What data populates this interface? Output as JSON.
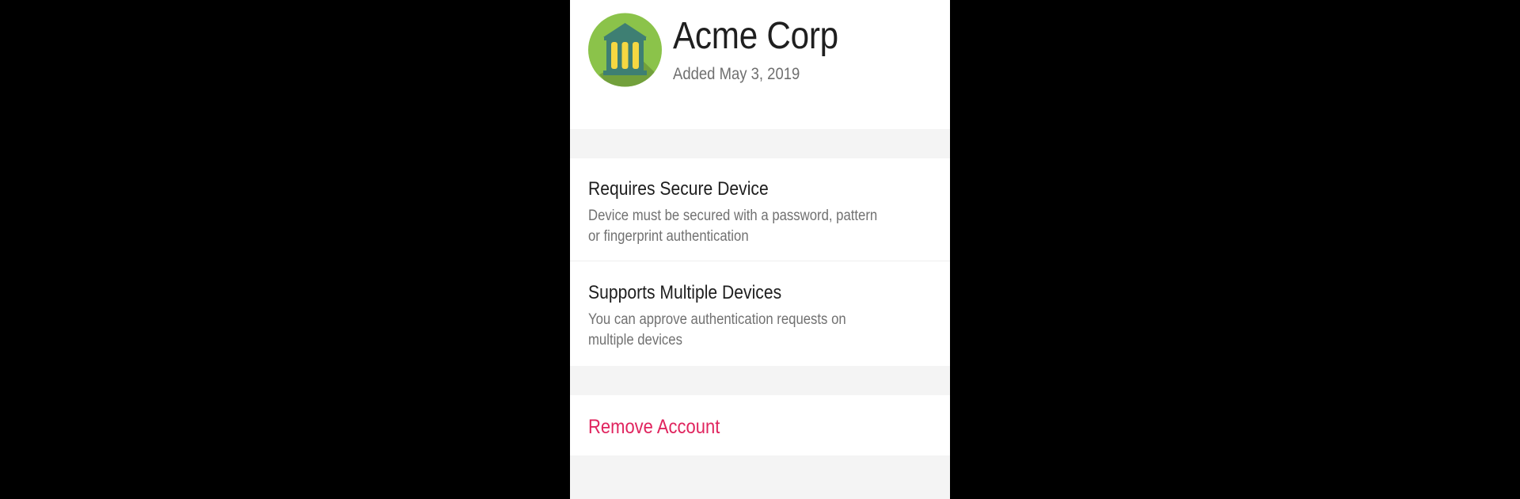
{
  "account": {
    "name": "Acme Corp",
    "added": "Added May 3, 2019",
    "avatar_icon": "bank-building-icon",
    "avatar_color": "#8bc34a"
  },
  "settings": [
    {
      "title": "Requires Secure Device",
      "description": "Device must be secured with a password, pattern or fingerprint authentication"
    },
    {
      "title": "Supports Multiple Devices",
      "description": "You can approve authentication requests on multiple devices"
    }
  ],
  "actions": {
    "remove_label": "Remove Account",
    "remove_color": "#e0245e"
  }
}
